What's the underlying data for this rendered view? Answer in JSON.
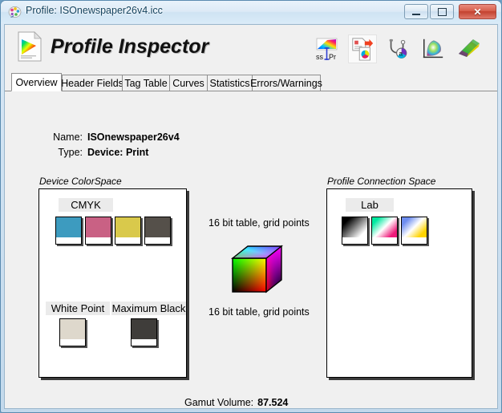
{
  "window": {
    "title": "Profile: ISOnewspaper26v4.icc",
    "title_icon": "color-palette-icon",
    "buttons": {
      "minimize": "minimize-button",
      "maximize": "maximize-button",
      "close": "close-button",
      "close_label": "✕"
    }
  },
  "header": {
    "app_title": "Profile Inspector",
    "app_icon": "profile-document-icon",
    "toolbar": [
      {
        "name": "srgb-to-profile-icon",
        "label": "ssPr"
      },
      {
        "name": "convert-document-icon",
        "label": ""
      },
      {
        "name": "stethoscope-inspect-icon",
        "label": ""
      },
      {
        "name": "chromaticity-diagram-icon",
        "label": ""
      },
      {
        "name": "gamut-3d-icon",
        "label": ""
      }
    ]
  },
  "tabs": [
    {
      "label": "Overview",
      "active": true
    },
    {
      "label": "Header Fields",
      "active": false
    },
    {
      "label": "Tag Table",
      "active": false
    },
    {
      "label": "Curves",
      "active": false
    },
    {
      "label": "Statistics",
      "active": false
    },
    {
      "label": "Errors/Warnings",
      "active": false
    }
  ],
  "info": {
    "name_label": "Name:",
    "name_value": "ISOnewspaper26v4",
    "type_label": "Type:",
    "type_value": "Device: Print"
  },
  "device_colorspace": {
    "caption": "Device ColorSpace",
    "group_label": "CMYK",
    "channels": [
      {
        "name": "cyan-swatch",
        "color": "#3d9bbf"
      },
      {
        "name": "magenta-swatch",
        "color": "#c96184"
      },
      {
        "name": "yellow-swatch",
        "color": "#d9c94b"
      },
      {
        "name": "black-swatch",
        "color": "#55504a"
      }
    ],
    "white_point_label": "White Point",
    "white_point_color": "#ded8cc",
    "maximum_black_label": "Maximum Black",
    "maximum_black_color": "#3f3d3a"
  },
  "center": {
    "table_top_text": "16 bit table,  grid points",
    "table_bottom_text": "16 bit table,  grid points",
    "cube_icon": "rgb-color-cube"
  },
  "profile_connection_space": {
    "caption": "Profile Connection Space",
    "group_label": "Lab",
    "channels": [
      {
        "name": "lab-l-swatch",
        "from": "#000000",
        "to": "#ffffff"
      },
      {
        "name": "lab-a-swatch",
        "from": "#00e9a0",
        "to": "#ee1a7a"
      },
      {
        "name": "lab-b-swatch",
        "from": "#6e8ef0",
        "to": "#ffd400"
      }
    ]
  },
  "gamut": {
    "label": "Gamut Volume:",
    "value": "87.524"
  }
}
